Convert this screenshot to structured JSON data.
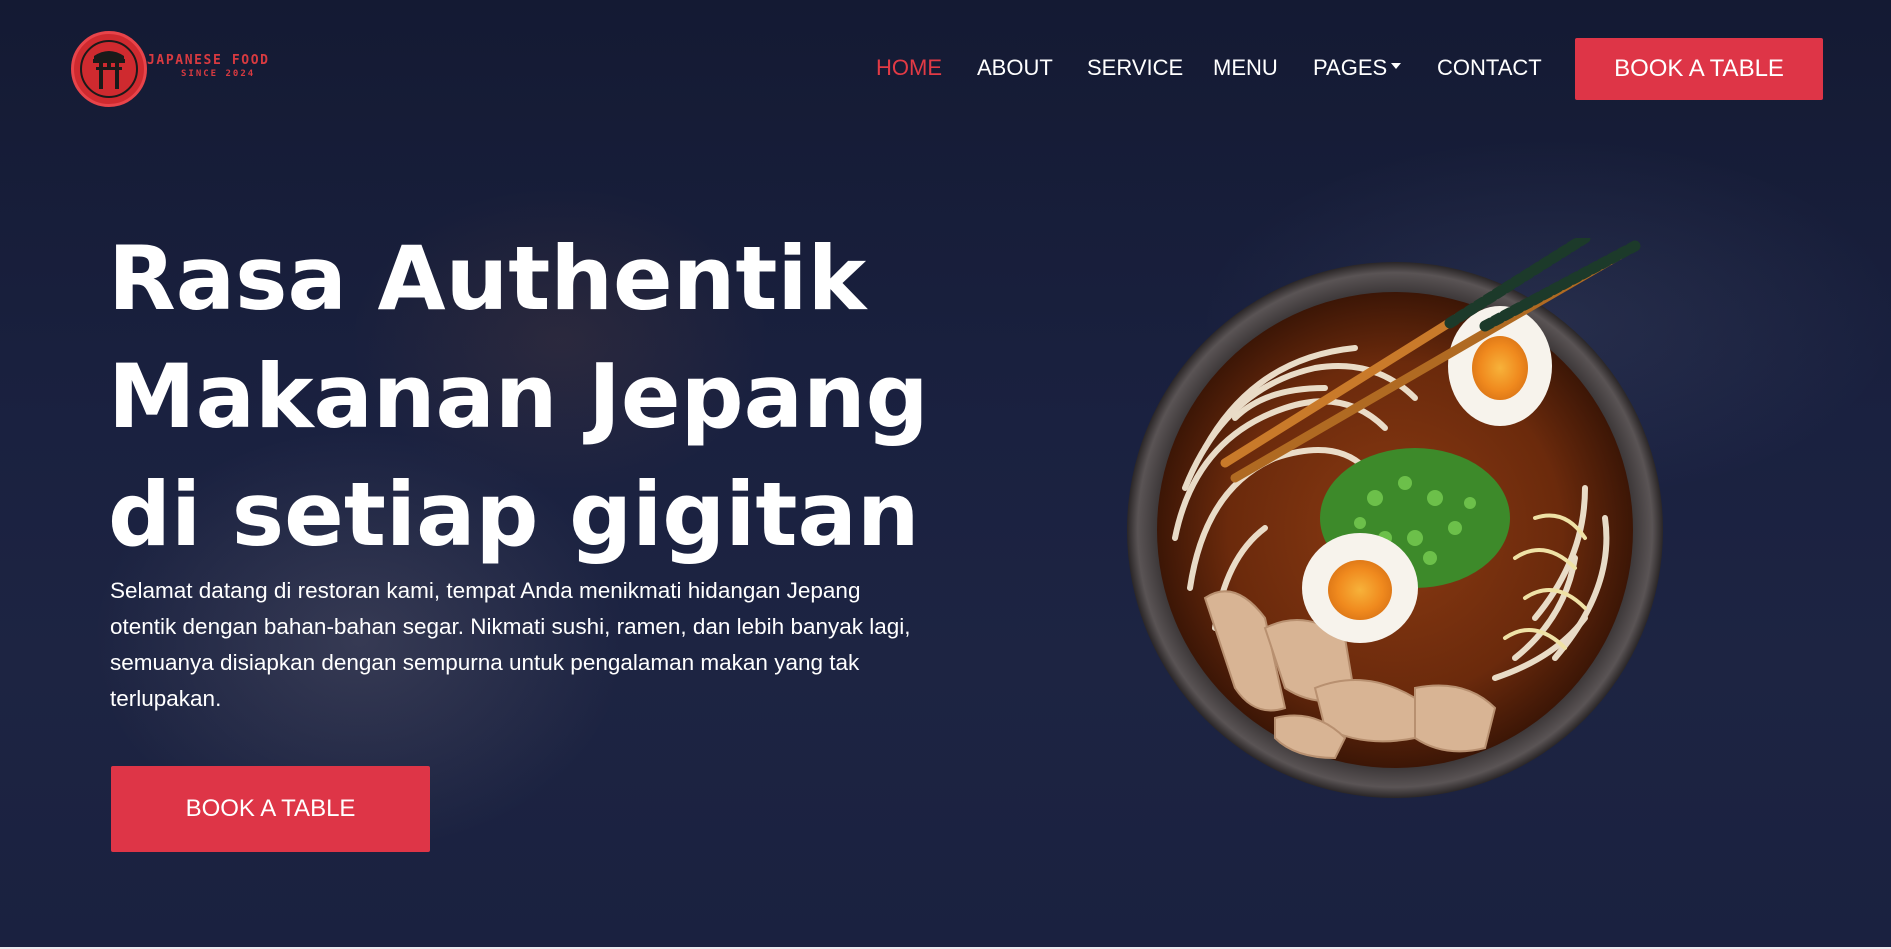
{
  "brand": {
    "name": "JAPANESE FOOD",
    "since": "SINCE 2024",
    "accent_color": "#de3547",
    "logo_icon": "torii-gate-icon"
  },
  "nav": {
    "items": [
      {
        "label": "HOME",
        "active": true
      },
      {
        "label": "ABOUT",
        "active": false
      },
      {
        "label": "SERVICE",
        "active": false
      },
      {
        "label": "MENU",
        "active": false
      },
      {
        "label": "PAGES",
        "active": false,
        "dropdown": true
      },
      {
        "label": "CONTACT",
        "active": false
      }
    ],
    "cta_label": "BOOK A TABLE"
  },
  "hero": {
    "title_lines": [
      "Rasa Authentik",
      "Makanan Jepang",
      "di setiap gigitan"
    ],
    "description": "Selamat datang di restoran kami, tempat Anda menikmati hidangan Jepang otentik dengan bahan-bahan segar. Nikmati sushi, ramen, dan lebih banyak lagi, semuanya disiapkan dengan sempurna untuk pengalaman makan yang tak terlupakan.",
    "cta_label": "BOOK A TABLE",
    "image_icon": "ramen-bowl-image"
  }
}
